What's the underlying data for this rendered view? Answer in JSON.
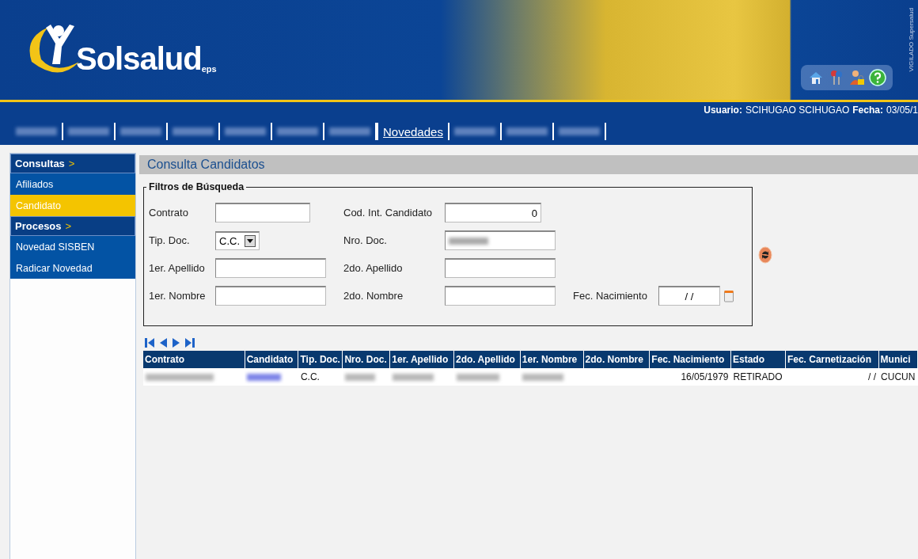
{
  "header": {
    "logo_text": "Solsalud",
    "logo_suffix": "eps",
    "side_text": "VIGILADO Supersalud"
  },
  "user_bar": {
    "user_label": "Usuario:",
    "user": "SCIHUGAO SCIHUGAO",
    "date_label": "Fecha:",
    "date": "03/05/1"
  },
  "tabs": [
    {
      "kind": "blurred",
      "selected": false
    },
    {
      "kind": "blurred",
      "selected": false
    },
    {
      "kind": "blurred",
      "selected": false
    },
    {
      "kind": "blurred",
      "selected": false
    },
    {
      "kind": "blurred",
      "selected": false
    },
    {
      "kind": "blurred",
      "selected": false
    },
    {
      "kind": "blurred",
      "selected": false
    },
    {
      "kind": "text",
      "label": "Novedades",
      "selected": true
    },
    {
      "kind": "blurred",
      "selected": false
    },
    {
      "kind": "blurred",
      "selected": false
    },
    {
      "kind": "blurred",
      "selected": false
    }
  ],
  "sidebar": [
    {
      "title": "Consultas",
      "arrow": ">",
      "items": [
        {
          "label": "Afiliados",
          "selected": false
        },
        {
          "label": "Candidato",
          "selected": true
        }
      ]
    },
    {
      "title": "Procesos",
      "arrow": ">",
      "items": [
        {
          "label": "Novedad SISBEN",
          "selected": false
        },
        {
          "label": "Radicar Novedad",
          "selected": false
        }
      ]
    }
  ],
  "page_title": "Consulta Candidatos",
  "filters": {
    "legend": "Filtros de Búsqueda",
    "rows": [
      [
        {
          "label": "Contrato",
          "kind": "text"
        },
        {
          "label": "Cod. Int. Candidato",
          "kind": "number",
          "value": "0"
        }
      ],
      [
        {
          "label": "Tip. Doc.",
          "kind": "select",
          "value": "C.C."
        },
        {
          "label": "Nro. Doc.",
          "kind": "blurred"
        }
      ],
      [
        {
          "label": "1er. Apellido",
          "kind": "text"
        },
        {
          "label": "2do. Apellido",
          "kind": "text"
        }
      ],
      [
        {
          "label": "1er. Nombre",
          "kind": "text"
        },
        {
          "label": "2do. Nombre",
          "kind": "text"
        },
        {
          "label": "Fec. Nacimiento",
          "kind": "date",
          "value": "/ /"
        }
      ]
    ]
  },
  "table": {
    "columns": [
      "Contrato",
      "Candidato",
      "Tip. Doc.",
      "Nro. Doc.",
      "1er. Apellido",
      "2do. Apellido",
      "1er. Nombre",
      "2do. Nombre",
      "Fec. Nacimiento",
      "Estado",
      "Fec. Carnetización",
      "Munici"
    ],
    "rows": [
      [
        {
          "kind": "blurred"
        },
        {
          "kind": "blurred_link"
        },
        {
          "kind": "text",
          "text": "C.C."
        },
        {
          "kind": "blurred"
        },
        {
          "kind": "blurred"
        },
        {
          "kind": "blurred"
        },
        {
          "kind": "blurred"
        },
        {
          "kind": "empty"
        },
        {
          "kind": "right",
          "text": "16/05/1979"
        },
        {
          "kind": "text",
          "text": "RETIRADO"
        },
        {
          "kind": "right",
          "text": "/ /"
        },
        {
          "kind": "text",
          "text": "CUCUN"
        }
      ]
    ]
  }
}
